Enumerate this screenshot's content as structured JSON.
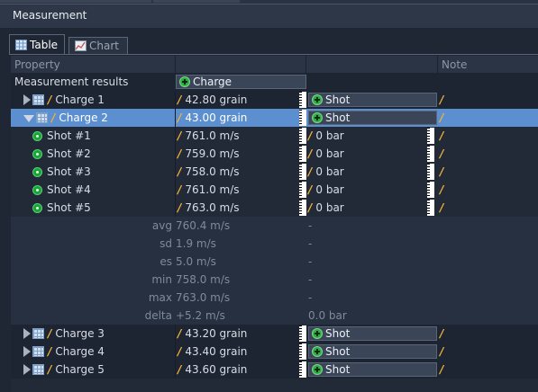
{
  "panel": {
    "title": "Measurement"
  },
  "tabs": [
    {
      "label": "Table"
    },
    {
      "label": "Chart"
    }
  ],
  "header": {
    "property": "Property",
    "note": "Note"
  },
  "results": {
    "label": "Measurement results",
    "add_charge": "Charge"
  },
  "shot_button": "Shot",
  "charges": [
    {
      "label": "Charge 1",
      "value": "42.80 grain",
      "expanded": false
    },
    {
      "label": "Charge 2",
      "value": "43.00 grain",
      "expanded": true
    },
    {
      "label": "Charge 3",
      "value": "43.20 grain",
      "expanded": false
    },
    {
      "label": "Charge 4",
      "value": "43.40 grain",
      "expanded": false
    },
    {
      "label": "Charge 5",
      "value": "43.60 grain",
      "expanded": false
    }
  ],
  "shots": [
    {
      "label": "Shot #1",
      "velocity": "761.0 m/s",
      "pressure": "0 bar"
    },
    {
      "label": "Shot #2",
      "velocity": "759.0 m/s",
      "pressure": "0 bar"
    },
    {
      "label": "Shot #3",
      "velocity": "758.0 m/s",
      "pressure": "0 bar"
    },
    {
      "label": "Shot #4",
      "velocity": "761.0 m/s",
      "pressure": "0 bar"
    },
    {
      "label": "Shot #5",
      "velocity": "763.0 m/s",
      "pressure": "0 bar"
    }
  ],
  "stats": [
    {
      "label": "avg",
      "value": "760.4 m/s",
      "extra": "-"
    },
    {
      "label": "sd",
      "value": "1.9 m/s",
      "extra": "-"
    },
    {
      "label": "es",
      "value": "5.0 m/s",
      "extra": "-"
    },
    {
      "label": "min",
      "value": "758.0 m/s",
      "extra": "-"
    },
    {
      "label": "max",
      "value": "763.0 m/s",
      "extra": "-"
    },
    {
      "label": "delta",
      "value": "+5.2 m/s",
      "extra": "0.0 bar"
    }
  ],
  "colors": {
    "selection": "#5b8fd0",
    "accent_slash": "#f0b23a",
    "add_green": "#2fae43"
  }
}
